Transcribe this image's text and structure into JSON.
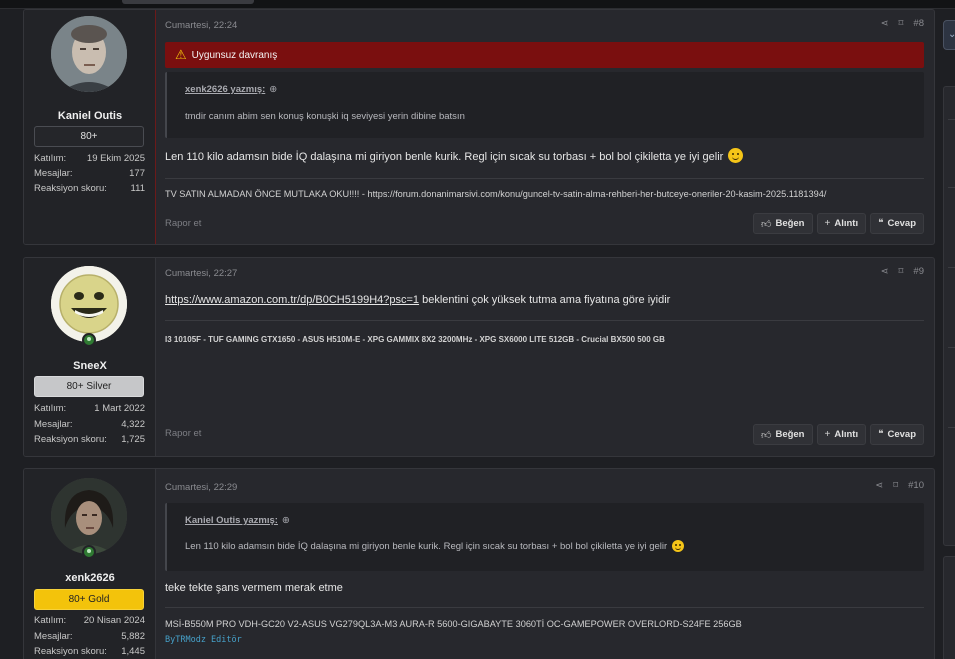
{
  "posts": [
    {
      "date": "Cumartesi, 22:24",
      "number": "#8",
      "warning": "Uygunsuz davranış",
      "user": {
        "name": "Kaniel Outis",
        "rank": "80+",
        "joined_label": "Katılım:",
        "joined": "19 Ekim 2025",
        "messages_label": "Mesajlar:",
        "messages": "177",
        "reaction_label": "Reaksiyon skoru:",
        "reaction": "111"
      },
      "quote": {
        "author": "xenk2626 yazmış:",
        "text": "tmdir canım abim sen konuş konuşki iq seviyesi yerin dibine batsın"
      },
      "body": "Len 110 kilo adamsın bide İQ dalaşına mi giriyon benle kurik. Regl için sıcak su torbası + bol bol çikiletta ye iyi gelir",
      "signature": "TV SATIN ALMADAN ÖNCE MUTLAKA OKU!!!! - https://forum.donanimarsivi.com/konu/guncel-tv-satin-alma-rehberi-her-butceye-oneriler-20-kasim-2025.1181394/",
      "report": "Rapor et"
    },
    {
      "date": "Cumartesi, 22:27",
      "number": "#9",
      "user": {
        "name": "SneeX",
        "rank": "80+ Silver",
        "joined_label": "Katılım:",
        "joined": "1 Mart 2022",
        "messages_label": "Mesajlar:",
        "messages": "4,322",
        "reaction_label": "Reaksiyon skoru:",
        "reaction": "1,725"
      },
      "body_link": "https://www.amazon.com.tr/dp/B0CH5199H4?psc=1",
      "body": " beklentini çok yüksek tutma ama fiyatına göre iyidir",
      "signature": "I3 10105F - TUF GAMING GTX1650 - ASUS H510M-E - XPG GAMMIX 8X2 3200MHz - XPG SX6000 LITE 512GB - Crucial BX500 500 GB",
      "report": "Rapor et"
    },
    {
      "date": "Cumartesi, 22:29",
      "number": "#10",
      "user": {
        "name": "xenk2626",
        "rank": "80+ Gold",
        "joined_label": "Katılım:",
        "joined": "20 Nisan 2024",
        "messages_label": "Mesajlar:",
        "messages": "5,882",
        "reaction_label": "Reaksiyon skoru:",
        "reaction": "1,445"
      },
      "quote": {
        "author": "Kaniel Outis yazmış:",
        "text": "Len 110 kilo adamsın bide İQ dalaşına mi giriyon benle kurik. Regl için sıcak su torbası + bol bol çikiletta ye iyi gelir"
      },
      "body": "teke tekte şans vermem merak etme",
      "signature": "MSİ-B550M PRO VDH-GC20 V2-ASUS VG279QL3A-M3 AURA-R 5600-GIGABAYTE 3060Tİ OC-GAMEPOWER OVERLORD-S24FE 256GB",
      "signature2": "ByTRModz Editör"
    }
  ],
  "buttons": {
    "like": "Beğen",
    "quote": "Alıntı",
    "reply": "Cevap"
  },
  "colors": {
    "warning": "#7a0f0f",
    "gold": "#f3c30b",
    "silver": "#c6c7c9"
  }
}
